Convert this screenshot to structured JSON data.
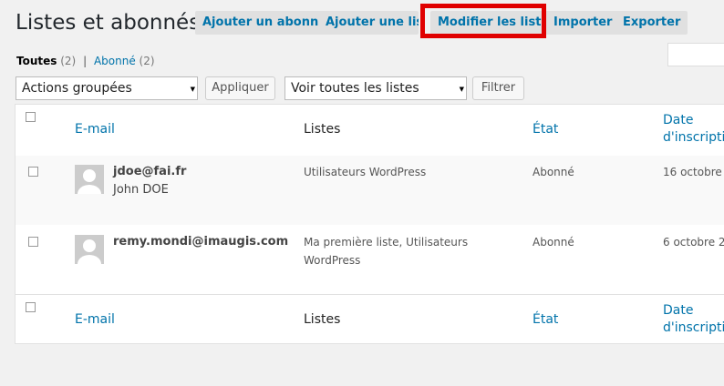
{
  "header": {
    "title": "Listes et abonnés",
    "buttons": [
      "Ajouter un abonné",
      "Ajouter une liste",
      "Modifier les listes",
      "Importer",
      "Exporter"
    ]
  },
  "filters": {
    "all_label": "Toutes",
    "all_count": "(2)",
    "separator": "|",
    "subscribed_label": "Abonné",
    "subscribed_count": "(2)"
  },
  "toolbar": {
    "bulk_actions": "Actions groupées",
    "apply_label": "Appliquer",
    "list_filter": "Voir toutes les listes",
    "filter_label": "Filtrer"
  },
  "table": {
    "columns": {
      "email": "E-mail",
      "lists": "Listes",
      "state": "État",
      "date_line1": "Date",
      "date_line2": "d'inscription"
    },
    "rows": [
      {
        "email": "jdoe@fai.fr",
        "name": "John DOE",
        "lists_line1": "Utilisateurs WordPress",
        "lists_line2": "",
        "state": "Abonné",
        "date": "16 octobre"
      },
      {
        "email": "remy.mondi@imaugis.com",
        "name": "",
        "lists_line1": "Ma première liste, Utilisateurs",
        "lists_line2": "WordPress",
        "state": "Abonné",
        "date": "6 octobre 2"
      }
    ]
  },
  "colors": {
    "accent": "#0073aa",
    "highlight": "#e00000",
    "background": "#f1f1f1"
  }
}
